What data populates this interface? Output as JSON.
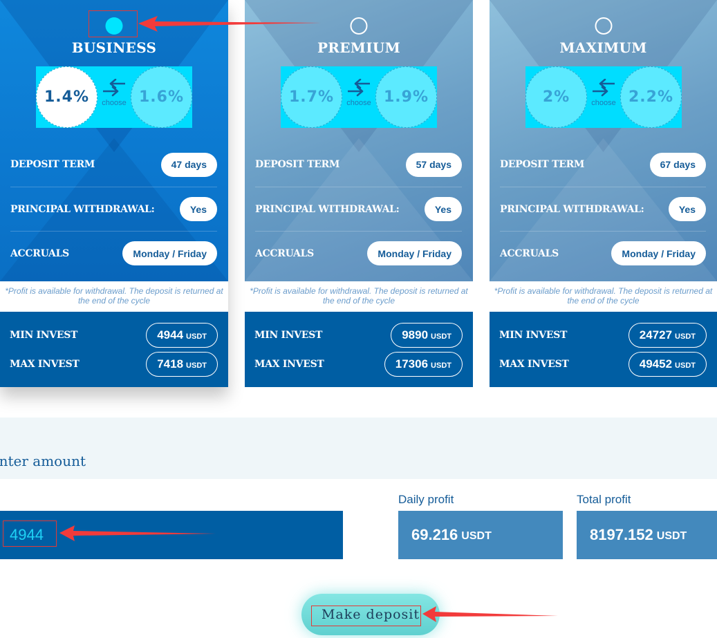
{
  "plans": [
    {
      "name": "BUSINESS",
      "selected": true,
      "rates": [
        "1.4%",
        "1.6%"
      ],
      "active_rate_index": 0,
      "choose_label": "choose",
      "rows": [
        {
          "label": "DEPOSIT TERM",
          "value": "47 days"
        },
        {
          "label": "PRINCIPAL WITHDRAWAL:",
          "value": "Yes"
        },
        {
          "label": "ACCRUALS",
          "value": "Monday / Friday"
        }
      ],
      "note": "*Profit is available for withdrawal. The deposit is returned at the end of the cycle",
      "min_invest": {
        "label": "MIN INVEST",
        "value": "4944",
        "unit": "USDT"
      },
      "max_invest": {
        "label": "MAX INVEST",
        "value": "7418",
        "unit": "USDT"
      }
    },
    {
      "name": "PREMIUM",
      "selected": false,
      "rates": [
        "1.7%",
        "1.9%"
      ],
      "active_rate_index": -1,
      "choose_label": "choose",
      "rows": [
        {
          "label": "DEPOSIT TERM",
          "value": "57 days"
        },
        {
          "label": "PRINCIPAL WITHDRAWAL:",
          "value": "Yes"
        },
        {
          "label": "ACCRUALS",
          "value": "Monday / Friday"
        }
      ],
      "note": "*Profit is available for withdrawal. The deposit is returned at the end of the cycle",
      "min_invest": {
        "label": "MIN INVEST",
        "value": "9890",
        "unit": "USDT"
      },
      "max_invest": {
        "label": "MAX INVEST",
        "value": "17306",
        "unit": "USDT"
      }
    },
    {
      "name": "MAXIMUM",
      "selected": false,
      "rates": [
        "2%",
        "2.2%"
      ],
      "active_rate_index": -1,
      "choose_label": "choose",
      "rows": [
        {
          "label": "DEPOSIT TERM",
          "value": "67 days"
        },
        {
          "label": "PRINCIPAL WITHDRAWAL:",
          "value": "Yes"
        },
        {
          "label": "ACCRUALS",
          "value": "Monday / Friday"
        }
      ],
      "note": "*Profit is available for withdrawal. The deposit is returned at the end of the cycle",
      "min_invest": {
        "label": "MIN INVEST",
        "value": "24727",
        "unit": "USDT"
      },
      "max_invest": {
        "label": "MAX INVEST",
        "value": "49452",
        "unit": "USDT"
      }
    }
  ],
  "amount": {
    "title": "Enter amount",
    "value": "4944"
  },
  "profits": {
    "daily": {
      "label": "Daily profit",
      "value": "69.216",
      "unit": "USDT"
    },
    "total": {
      "label": "Total profit",
      "value": "8197.152",
      "unit": "USDT"
    }
  },
  "deposit_button": {
    "label": "Make deposit"
  },
  "colors": {
    "selected_card": "#0f87dc",
    "unselected_card": "#6b9fc6",
    "invest_band": "#005ea3",
    "accent_cyan": "#00ddff",
    "profit_box": "#4389bd",
    "button": "#6fdcda",
    "annotation_red": "#e53935"
  }
}
